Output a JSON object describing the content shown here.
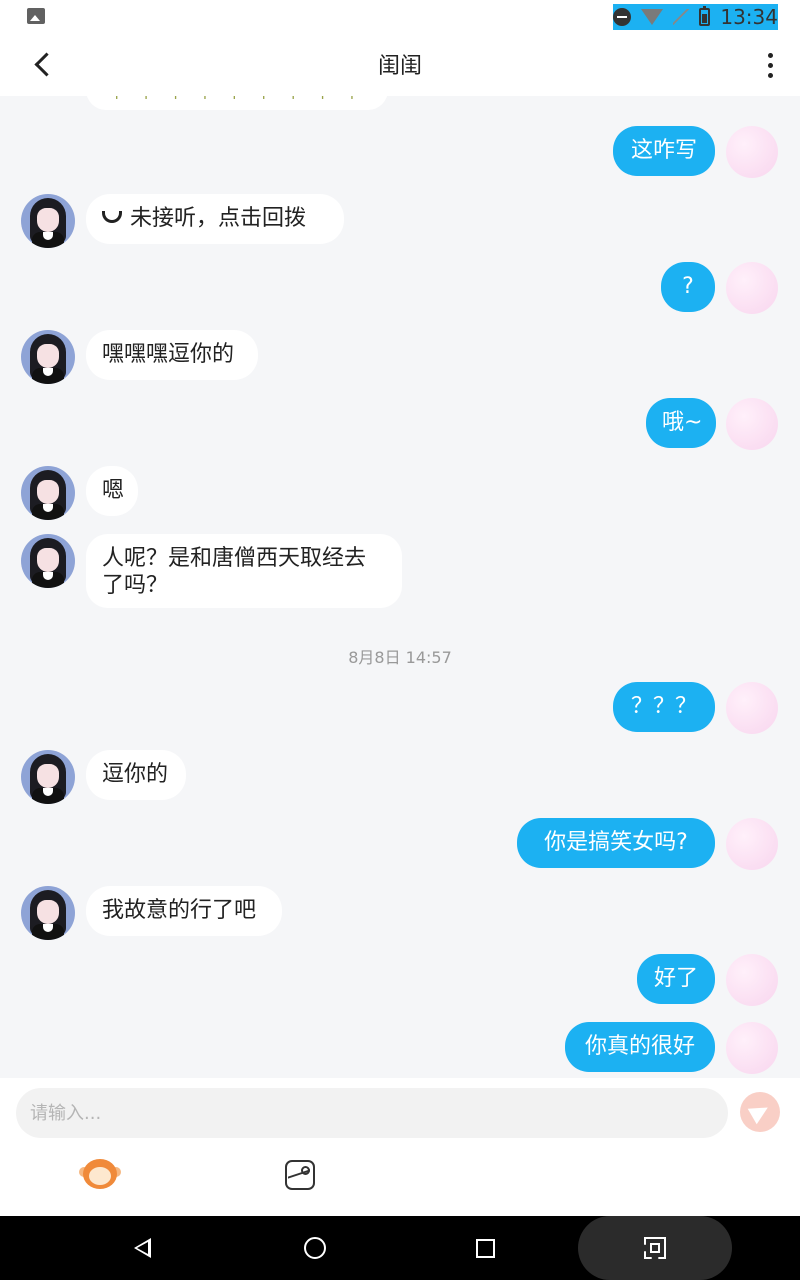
{
  "status": {
    "time": "13:34"
  },
  "header": {
    "title": "闺闺"
  },
  "partial_bubble": "+++++++++",
  "messages": [
    {
      "side": "right",
      "text": "这咋写"
    },
    {
      "side": "left",
      "type": "missed-call",
      "text": "未接听，点击回拨"
    },
    {
      "side": "right",
      "text": "?"
    },
    {
      "side": "left",
      "text": "嘿嘿嘿逗你的"
    },
    {
      "side": "right",
      "text": "哦~"
    },
    {
      "side": "left",
      "text": "嗯"
    },
    {
      "side": "left",
      "text": "人呢？是和唐僧西天取经去了吗？",
      "lines": [
        "人呢？是和唐僧西天取经去",
        "了吗？"
      ]
    },
    {
      "type": "timestamp",
      "text": "8月8日 14:57"
    },
    {
      "side": "right",
      "text": "？？？"
    },
    {
      "side": "left",
      "text": "逗你的"
    },
    {
      "side": "right",
      "text": "你是搞笑女吗?"
    },
    {
      "side": "left",
      "text": "我故意的行了吧"
    },
    {
      "side": "right",
      "text": "好了"
    },
    {
      "side": "right",
      "text": "你真的很好"
    }
  ],
  "composer": {
    "placeholder": "请输入..."
  },
  "icons": {
    "back": "chevron-left-icon",
    "more": "more-vertical-icon",
    "send": "send-icon",
    "emoji": "monkey-emoji-icon",
    "image": "image-icon"
  }
}
